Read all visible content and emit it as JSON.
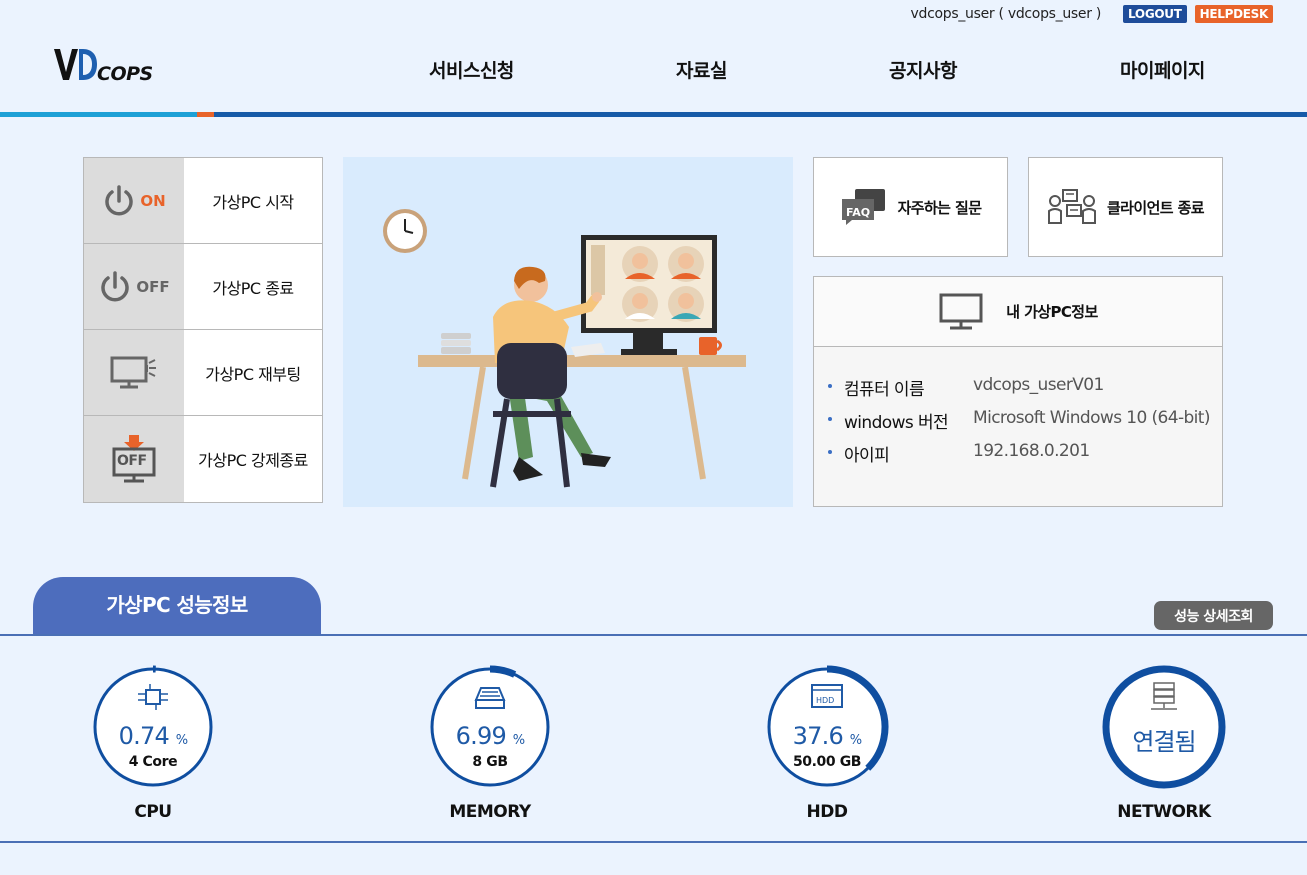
{
  "topbar": {
    "user": "vdcops_user ( vdcops_user )",
    "logout": "LOGOUT",
    "helpdesk": "HELPDESK"
  },
  "logo": {
    "text": "VDCOPS"
  },
  "nav": [
    "서비스신청",
    "자료실",
    "공지사항",
    "마이페이지"
  ],
  "controls": [
    {
      "label": "가상PC 시작",
      "icon": "power-on-icon",
      "icon_text": "ON",
      "icon_color": "#e8632a"
    },
    {
      "label": "가상PC 종료",
      "icon": "power-off-icon",
      "icon_text": "OFF",
      "icon_color": "#666666"
    },
    {
      "label": "가상PC 재부팅",
      "icon": "monitor-reboot-icon"
    },
    {
      "label": "가상PC 강제종료",
      "icon": "force-off-icon",
      "icon_text": "OFF"
    }
  ],
  "quick": {
    "faq": {
      "label": "자주하는 질문",
      "badge": "FAQ"
    },
    "client_exit": {
      "label": "클라이언트 종료"
    }
  },
  "pcinfo": {
    "title": "내 가상PC정보",
    "rows": [
      {
        "key": "컴퓨터 이름",
        "value": "vdcops_userV01"
      },
      {
        "key": "windows 버전",
        "value": "Microsoft Windows 10 (64-bit)"
      },
      {
        "key": "아이피",
        "value": "192.168.0.201"
      }
    ]
  },
  "performance": {
    "tab": "가상PC 성능정보",
    "detail_button": "성능 상세조회",
    "gauges": [
      {
        "name": "CPU",
        "value": "0.74",
        "unit": "%",
        "sub": "4 Core",
        "percent": 0.74,
        "icon": "cpu-icon"
      },
      {
        "name": "MEMORY",
        "value": "6.99",
        "unit": "%",
        "sub": "8 GB",
        "percent": 6.99,
        "icon": "memory-icon"
      },
      {
        "name": "HDD",
        "value": "37.6",
        "unit": "%",
        "sub": "50.00 GB",
        "percent": 37.6,
        "icon": "hdd-icon",
        "icon_text": "HDD"
      },
      {
        "name": "NETWORK",
        "status": "연결됨",
        "icon": "network-icon"
      }
    ]
  },
  "colors": {
    "accent": "#1f5aa6",
    "orange": "#e8632a",
    "tab": "#4d6dbd",
    "ring": "#0f4ea0"
  }
}
